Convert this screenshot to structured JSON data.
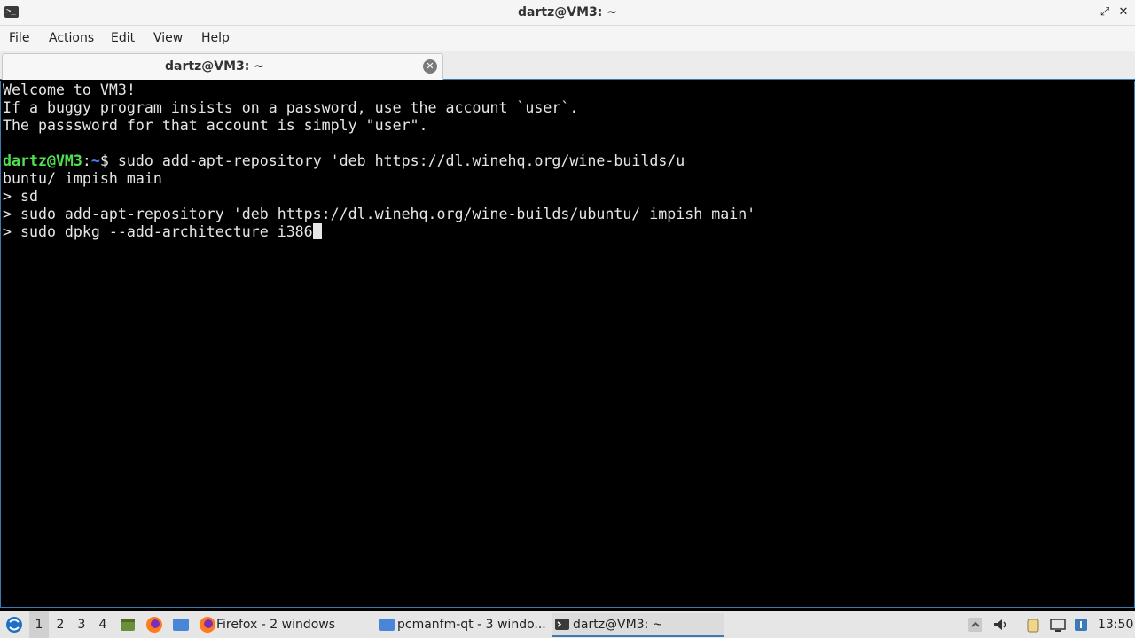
{
  "window": {
    "title": "dartz@VM3: ~",
    "minimize": "‒",
    "maximize": "⤢",
    "close": "✕"
  },
  "menu": [
    "File",
    "Actions",
    "Edit",
    "View",
    "Help"
  ],
  "tab": {
    "label": "dartz@VM3: ~",
    "close": "✕"
  },
  "terminal": {
    "welcome": [
      "Welcome to VM3!",
      "If a buggy program insists on a password, use the account `user`.",
      "The passsword for that account is simply \"user\"."
    ],
    "prompt_user": "dartz@VM3",
    "prompt_sep": ":",
    "prompt_path": "~",
    "prompt_dollar": "$ ",
    "command": "sudo add-apt-repository 'deb https://dl.winehq.org/wine-builds/u",
    "command_wrap": "buntu/ impish main",
    "continuation": [
      "> sd",
      "> sudo add-apt-repository 'deb https://dl.winehq.org/wine-builds/ubuntu/ impish main'",
      "> sudo dpkg --add-architecture i386"
    ]
  },
  "taskbar": {
    "workspaces": [
      "1",
      "2",
      "3",
      "4"
    ],
    "active_workspace": "1",
    "tasks": [
      {
        "label": "Firefox - 2 windows",
        "icon": "firefox-icon"
      },
      {
        "label": "pcmanfm-qt - 3 windo...",
        "icon": "folder-icon"
      },
      {
        "label": "dartz@VM3: ~",
        "icon": "terminal-icon"
      }
    ],
    "clock": "13:50"
  },
  "colors": {
    "accent": "#3b7ab8",
    "prompt_user": "#4ee24e",
    "prompt_path": "#4f7cff",
    "terminal_bg": "#000000",
    "terminal_fg": "#e6e6e6"
  }
}
